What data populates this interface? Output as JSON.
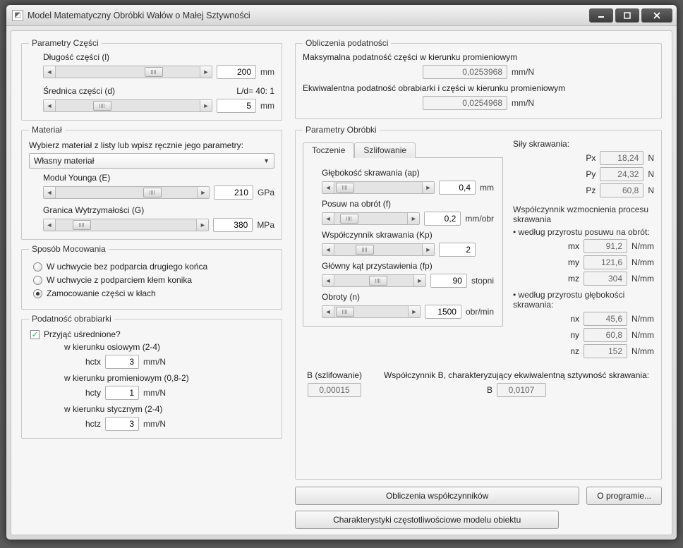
{
  "window": {
    "title": "Model Matematyczny Obróbki Wałów o Małej Sztywności"
  },
  "part": {
    "legend": "Parametry Części",
    "length_label": "Długość części (l)",
    "length_value": "200",
    "length_unit": "mm",
    "diameter_label": "Średnica części (d)",
    "ratio_label": "L/d=  40: 1",
    "diameter_value": "5",
    "diameter_unit": "mm"
  },
  "material": {
    "legend": "Materiał",
    "choose_label": "Wybierz materiał z listy lub wpisz ręcznie jego parametry:",
    "selected": "Własny materiał",
    "young_label": "Moduł Younga (E)",
    "young_value": "210",
    "young_unit": "GPa",
    "strength_label": "Granica Wytrzymałości (G)",
    "strength_value": "380",
    "strength_unit": "MPa"
  },
  "mount": {
    "legend": "Sposób Mocowania",
    "opt1": "W uchwycie bez podparcia drugiego końca",
    "opt2": "W uchwycie z podparciem kłem konika",
    "opt3": "Zamocowanie części w kłach"
  },
  "compliance": {
    "legend": "Podatność obrabiarki",
    "avg_label": "Przyjąć uśrednione?",
    "axis_label": "w kierunku osiowym (2-4)",
    "hctx_name": "hctx",
    "hctx_value": "3",
    "hctx_unit": "mm/N",
    "radial_label": "w kierunku promieniowym (0,8-2)",
    "hcty_name": "hcty",
    "hcty_value": "1",
    "hcty_unit": "mm/N",
    "tangent_label": "w kierunku stycznym (2-4)",
    "hctz_name": "hctz",
    "hctz_value": "3",
    "hctz_unit": "mm/N"
  },
  "calc_comp": {
    "legend": "Obliczenia podatności",
    "max_label": "Maksymalna podatność części w kierunku promieniowym",
    "max_value": "0,0253968",
    "max_unit": "mm/N",
    "eq_label": "Ekwiwalentna podatność obrabiarki i części w kierunku promieniowym",
    "eq_value": "0,0254968",
    "eq_unit": "mm/N"
  },
  "machining": {
    "legend": "Parametry Obróbki",
    "tab1": "Toczenie",
    "tab2": "Szlifowanie",
    "ap_label": "Głębokość skrawania (ap)",
    "ap_value": "0,4",
    "ap_unit": "mm",
    "f_label": "Posuw na obrót (f)",
    "f_value": "0,2",
    "f_unit": "mm/obr",
    "kp_label": "Współczynnik skrawania (Kp)",
    "kp_value": "2",
    "fp_label": "Główny kąt przystawienia  (fp)",
    "fp_value": "90",
    "fp_unit": "stopni",
    "n_label": "Obroty (n)",
    "n_value": "1500",
    "n_unit": "obr/min"
  },
  "forces": {
    "title": "Siły skrawania:",
    "px_name": "Px",
    "px_value": "18,24",
    "px_unit": "N",
    "py_name": "Py",
    "py_value": "24,32",
    "py_unit": "N",
    "pz_name": "Pz",
    "pz_value": "60,8",
    "pz_unit": "N"
  },
  "gain": {
    "title": "Współczynnik wzmocnienia procesu skrawania",
    "byf": "• według przyrostu posuwu na obrót:",
    "mx_name": "mx",
    "mx_value": "91,2",
    "mx_unit": "N/mm",
    "my_name": "my",
    "my_value": "121,6",
    "my_unit": "N/mm",
    "mz_name": "mz",
    "mz_value": "304",
    "mz_unit": "N/mm",
    "byap": "• według przyrostu głębokości skrawania:",
    "nx_name": "nx",
    "nx_value": "45,6",
    "nx_unit": "N/mm",
    "ny_name": "ny",
    "ny_value": "60,8",
    "ny_unit": "N/mm",
    "nz_name": "nz",
    "nz_value": "152",
    "nz_unit": "N/mm"
  },
  "bcoef": {
    "bgrind_label": "B (szlifowanie)",
    "bgrind_value": "0,00015",
    "beq_label": "Współczynnik B, charakteryzujący ekwiwalentną sztywność skrawania:",
    "beq_name": "B",
    "beq_value": "0,0107"
  },
  "buttons": {
    "calc": "Obliczenia współczynników",
    "about": "O programie...",
    "freq": "Charakterystyki częstotliwościowe modelu obiektu"
  }
}
